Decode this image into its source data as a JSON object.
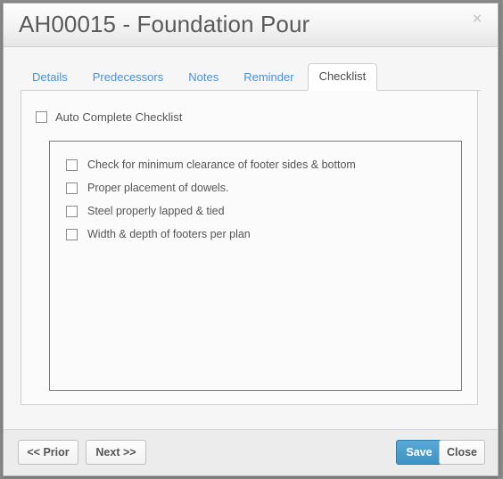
{
  "window": {
    "title": "AH00015 - Foundation Pour",
    "close_icon": "close-icon",
    "close_glyph": "×"
  },
  "tabs": [
    {
      "label": "Details",
      "active": false
    },
    {
      "label": "Predecessors",
      "active": false
    },
    {
      "label": "Notes",
      "active": false
    },
    {
      "label": "Reminder",
      "active": false
    },
    {
      "label": "Checklist",
      "active": true
    }
  ],
  "checklist_panel": {
    "auto_complete": {
      "label": "Auto Complete Checklist",
      "checked": false
    },
    "items": [
      {
        "label": "Check for minimum clearance of footer sides & bottom",
        "checked": false
      },
      {
        "label": "Proper placement of dowels.",
        "checked": false
      },
      {
        "label": "Steel properly lapped & tied",
        "checked": false
      },
      {
        "label": "Width & depth of footers per plan",
        "checked": false
      }
    ]
  },
  "footer": {
    "prior_label": "<< Prior",
    "next_label": "Next >>",
    "save_label": "Save",
    "close_label": "Close"
  },
  "colors": {
    "accent_blue": "#3f93c4",
    "tab_link": "#4a90d9",
    "title_text": "#5a5a5a",
    "footer_bg": "#ececec"
  }
}
